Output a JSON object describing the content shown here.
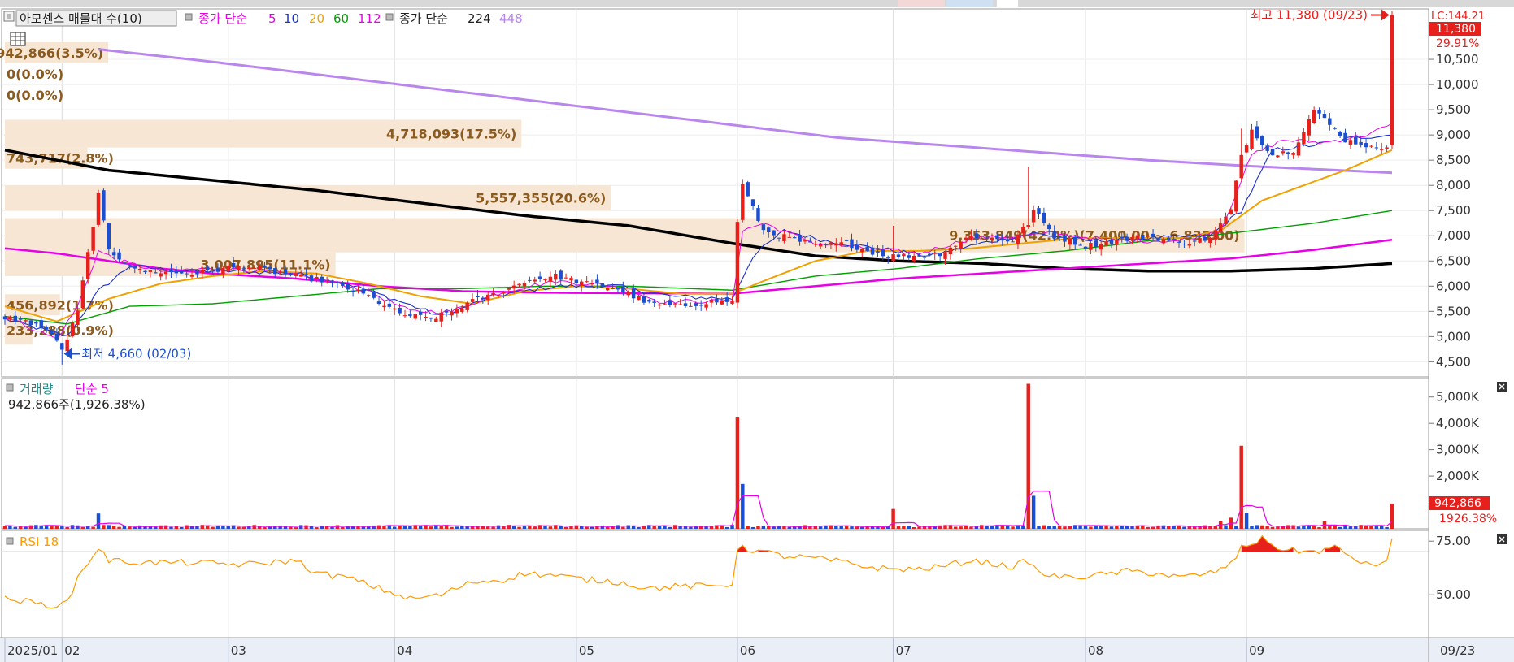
{
  "header": {
    "indicator_label": "아모센스 매물대 수(10)",
    "ma_label": "종가 단순",
    "ma_periods": [
      "5",
      "10",
      "20",
      "60",
      "112"
    ],
    "ma_periods_colors": [
      "#e800e8",
      "#1a30c8",
      "#f0a000",
      "#00a000",
      "#e800e8"
    ],
    "ma2_label": "종가 단순",
    "ma2_periods": [
      "224",
      "448"
    ],
    "ma2_periods_colors": [
      "#000000",
      "#b986ee"
    ],
    "right_top_label": "LC:144.21"
  },
  "price_panel": {
    "y_ticks": [
      "10,500",
      "10,000",
      "9,500",
      "9,000",
      "8,500",
      "8,000",
      "7,500",
      "7,000",
      "6,500",
      "6,000",
      "5,500",
      "5,000",
      "4,500"
    ],
    "y_tick_values": [
      10500,
      10000,
      9500,
      9000,
      8500,
      8000,
      7500,
      7000,
      6500,
      6000,
      5500,
      5000,
      4500
    ],
    "ylim": [
      4200,
      11500
    ],
    "current_price_tag": "11,380",
    "current_change_tag": "29.91%",
    "high_annotation": "최고 11,380 (09/23)",
    "low_annotation": "최저 4,660 (02/03)",
    "volume_profile": [
      {
        "label": "942,866(3.5%)",
        "low": 10420,
        "high": 10840,
        "frac": 0.075
      },
      {
        "label": "0(0.0%)",
        "low": 10000,
        "high": 10420,
        "frac": 0.0
      },
      {
        "label": "0(0.0%)",
        "low": 9590,
        "high": 10000,
        "frac": 0.0
      },
      {
        "label": "4,718,093(17.5%)",
        "low": 8750,
        "high": 9300,
        "frac": 0.375
      },
      {
        "label": "743,717(2.8%)",
        "low": 8330,
        "high": 8750,
        "frac": 0.06
      },
      {
        "label": "5,557,355(20.6%)",
        "low": 7500,
        "high": 8000,
        "frac": 0.44
      },
      {
        "label": "9,353,849(42.0%)(7,400.00 ~ 6,830.00)",
        "low": 6670,
        "high": 7350,
        "frac": 0.9
      },
      {
        "label": "3,007,895(11.1%)",
        "low": 6200,
        "high": 6670,
        "frac": 0.24
      },
      {
        "label": "456,892(1.7%)",
        "low": 5420,
        "high": 5840,
        "frac": 0.04
      },
      {
        "label": "233,288(0.9%)",
        "low": 4840,
        "high": 5420,
        "frac": 0.02
      }
    ]
  },
  "volume_panel": {
    "title": "거래량",
    "ma_label": "단순 5",
    "info": "942,866주(1,926.38%)",
    "y_ticks": [
      "5,000K",
      "4,000K",
      "3,000K",
      "2,000K",
      "1,000K"
    ],
    "y_tick_values": [
      5000,
      4000,
      3000,
      2000,
      1000
    ],
    "ylim": [
      0,
      5700
    ],
    "current_tag": "942,866",
    "current_pct": "1926.38%"
  },
  "rsi_panel": {
    "title": "RSI 18",
    "y_ticks": [
      "75.00",
      "50.00"
    ],
    "y_tick_values": [
      75,
      50
    ],
    "ylim": [
      30,
      80
    ]
  },
  "x_axis": {
    "labels": [
      "2025/01",
      "02",
      "03",
      "04",
      "05",
      "06",
      "07",
      "08",
      "09"
    ],
    "label_index": [
      0,
      11,
      43,
      75,
      110,
      141,
      171,
      208,
      239
    ],
    "right_label": "09/23"
  },
  "colors": {
    "up": "#e8201c",
    "down": "#1b4fd0",
    "ma5": "#e800e8",
    "ma10": "#1a30c8",
    "ma20": "#f0a000",
    "ma60": "#00a000",
    "ma112": "#e800e8",
    "ma224": "#000000",
    "ma448": "#b986ee",
    "rsi": "#ff9900",
    "profile": "#f7e6d3",
    "profile_text": "#8b5a1e",
    "grid": "#dcdcdc"
  },
  "chart_data": {
    "type": "candlestick",
    "title": "아모센스",
    "x_range": [
      "2025/01",
      "09/23"
    ],
    "ylim": [
      4200,
      11500
    ],
    "high": {
      "value": 11380,
      "date": "09/23"
    },
    "low": {
      "value": 4660,
      "date": "02/03"
    },
    "anchors": [
      [
        0,
        5380
      ],
      [
        6,
        5250
      ],
      [
        10,
        4950
      ],
      [
        11,
        4700
      ],
      [
        14,
        5500
      ],
      [
        18,
        7800
      ],
      [
        20,
        6700
      ],
      [
        26,
        6300
      ],
      [
        36,
        6250
      ],
      [
        46,
        6400
      ],
      [
        56,
        6200
      ],
      [
        62,
        6100
      ],
      [
        70,
        5800
      ],
      [
        76,
        5450
      ],
      [
        82,
        5350
      ],
      [
        86,
        5500
      ],
      [
        90,
        5700
      ],
      [
        96,
        5900
      ],
      [
        100,
        6100
      ],
      [
        106,
        6200
      ],
      [
        112,
        6050
      ],
      [
        118,
        5950
      ],
      [
        124,
        5650
      ],
      [
        130,
        5600
      ],
      [
        136,
        5700
      ],
      [
        140,
        5700
      ],
      [
        141,
        7300
      ],
      [
        142,
        8000
      ],
      [
        146,
        7100
      ],
      [
        156,
        6800
      ],
      [
        162,
        6850
      ],
      [
        166,
        6700
      ],
      [
        170,
        6600
      ],
      [
        176,
        6600
      ],
      [
        180,
        6650
      ],
      [
        186,
        7000
      ],
      [
        194,
        6900
      ],
      [
        197,
        7250
      ],
      [
        198,
        7500
      ],
      [
        202,
        7000
      ],
      [
        208,
        6800
      ],
      [
        214,
        6900
      ],
      [
        220,
        7000
      ],
      [
        226,
        6850
      ],
      [
        232,
        6950
      ],
      [
        236,
        7500
      ],
      [
        238,
        8600
      ],
      [
        240,
        9100
      ],
      [
        244,
        8600
      ],
      [
        248,
        8700
      ],
      [
        252,
        9500
      ],
      [
        258,
        8900
      ],
      [
        262,
        8800
      ],
      [
        264,
        8700
      ],
      [
        266,
        8800
      ],
      [
        267,
        11380
      ]
    ],
    "ma_anchors": {
      "ma5": [
        [
          0,
          5400
        ],
        [
          10,
          4950
        ],
        [
          14,
          5600
        ],
        [
          18,
          6700
        ],
        [
          22,
          6500
        ],
        [
          30,
          6300
        ],
        [
          40,
          6350
        ],
        [
          50,
          6300
        ],
        [
          60,
          6150
        ],
        [
          70,
          5900
        ],
        [
          78,
          5500
        ],
        [
          86,
          5500
        ],
        [
          96,
          5900
        ],
        [
          106,
          6100
        ],
        [
          118,
          6000
        ],
        [
          126,
          5700
        ],
        [
          140,
          5700
        ],
        [
          142,
          7100
        ],
        [
          146,
          7250
        ],
        [
          156,
          6850
        ],
        [
          166,
          6750
        ],
        [
          176,
          6650
        ],
        [
          186,
          6950
        ],
        [
          196,
          7000
        ],
        [
          202,
          7050
        ],
        [
          214,
          6900
        ],
        [
          226,
          6900
        ],
        [
          234,
          7100
        ],
        [
          240,
          8600
        ],
        [
          246,
          8900
        ],
        [
          254,
          8850
        ],
        [
          262,
          9000
        ],
        [
          267,
          9200
        ]
      ],
      "ma10": [
        [
          0,
          5350
        ],
        [
          12,
          5000
        ],
        [
          18,
          5900
        ],
        [
          24,
          6400
        ],
        [
          34,
          6300
        ],
        [
          44,
          6300
        ],
        [
          56,
          6250
        ],
        [
          66,
          6050
        ],
        [
          76,
          5700
        ],
        [
          84,
          5400
        ],
        [
          94,
          5800
        ],
        [
          106,
          6000
        ],
        [
          118,
          6000
        ],
        [
          128,
          5800
        ],
        [
          140,
          5750
        ],
        [
          144,
          6600
        ],
        [
          150,
          7100
        ],
        [
          158,
          6900
        ],
        [
          168,
          6750
        ],
        [
          178,
          6600
        ],
        [
          188,
          6850
        ],
        [
          198,
          7050
        ],
        [
          208,
          6900
        ],
        [
          220,
          6950
        ],
        [
          232,
          7000
        ],
        [
          238,
          7500
        ],
        [
          244,
          8700
        ],
        [
          252,
          8800
        ],
        [
          260,
          8950
        ],
        [
          267,
          9000
        ]
      ],
      "ma20": [
        [
          0,
          5600
        ],
        [
          10,
          5300
        ],
        [
          20,
          5750
        ],
        [
          30,
          6050
        ],
        [
          40,
          6200
        ],
        [
          50,
          6300
        ],
        [
          60,
          6250
        ],
        [
          70,
          6050
        ],
        [
          80,
          5800
        ],
        [
          90,
          5650
        ],
        [
          100,
          5900
        ],
        [
          110,
          6000
        ],
        [
          120,
          5950
        ],
        [
          130,
          5850
        ],
        [
          140,
          5850
        ],
        [
          146,
          6100
        ],
        [
          156,
          6500
        ],
        [
          166,
          6700
        ],
        [
          176,
          6700
        ],
        [
          186,
          6750
        ],
        [
          196,
          6850
        ],
        [
          206,
          6950
        ],
        [
          216,
          6950
        ],
        [
          226,
          6950
        ],
        [
          234,
          7100
        ],
        [
          242,
          7700
        ],
        [
          250,
          8000
        ],
        [
          258,
          8300
        ],
        [
          267,
          8700
        ]
      ],
      "ma60": [
        [
          0,
          5400
        ],
        [
          12,
          5250
        ],
        [
          24,
          5600
        ],
        [
          40,
          5650
        ],
        [
          56,
          5800
        ],
        [
          72,
          5950
        ],
        [
          88,
          5950
        ],
        [
          104,
          6000
        ],
        [
          120,
          6000
        ],
        [
          140,
          5920
        ],
        [
          156,
          6200
        ],
        [
          172,
          6350
        ],
        [
          188,
          6550
        ],
        [
          204,
          6700
        ],
        [
          220,
          6900
        ],
        [
          236,
          7050
        ],
        [
          252,
          7250
        ],
        [
          267,
          7500
        ]
      ],
      "ma112": [
        [
          0,
          6750
        ],
        [
          10,
          6650
        ],
        [
          20,
          6500
        ],
        [
          30,
          6350
        ],
        [
          40,
          6250
        ],
        [
          56,
          6150
        ],
        [
          72,
          6000
        ],
        [
          88,
          5900
        ],
        [
          104,
          5870
        ],
        [
          120,
          5860
        ],
        [
          140,
          5850
        ],
        [
          156,
          6000
        ],
        [
          172,
          6150
        ],
        [
          188,
          6250
        ],
        [
          204,
          6350
        ],
        [
          220,
          6450
        ],
        [
          236,
          6550
        ],
        [
          252,
          6720
        ],
        [
          267,
          6920
        ]
      ],
      "ma224": [
        [
          0,
          8700
        ],
        [
          20,
          8300
        ],
        [
          40,
          8100
        ],
        [
          60,
          7900
        ],
        [
          80,
          7650
        ],
        [
          100,
          7400
        ],
        [
          120,
          7200
        ],
        [
          140,
          6850
        ],
        [
          156,
          6600
        ],
        [
          172,
          6500
        ],
        [
          188,
          6450
        ],
        [
          204,
          6350
        ],
        [
          220,
          6300
        ],
        [
          236,
          6300
        ],
        [
          252,
          6350
        ],
        [
          267,
          6450
        ]
      ],
      "ma448": [
        [
          18,
          10700
        ],
        [
          40,
          10450
        ],
        [
          60,
          10200
        ],
        [
          80,
          9950
        ],
        [
          100,
          9700
        ],
        [
          120,
          9450
        ],
        [
          140,
          9200
        ],
        [
          160,
          8950
        ],
        [
          180,
          8800
        ],
        [
          200,
          8650
        ],
        [
          220,
          8500
        ],
        [
          240,
          8380
        ],
        [
          267,
          8250
        ]
      ]
    },
    "volume_spikes": [
      {
        "index": 18,
        "value": 580,
        "dir": "down"
      },
      {
        "index": 141,
        "value": 4250,
        "dir": "up"
      },
      {
        "index": 142,
        "value": 1700,
        "dir": "down"
      },
      {
        "index": 171,
        "value": 750,
        "dir": "up"
      },
      {
        "index": 197,
        "value": 5500,
        "dir": "up"
      },
      {
        "index": 198,
        "value": 1250,
        "dir": "down"
      },
      {
        "index": 234,
        "value": 300,
        "dir": "up"
      },
      {
        "index": 236,
        "value": 420,
        "dir": "up"
      },
      {
        "index": 238,
        "value": 3150,
        "dir": "up"
      },
      {
        "index": 239,
        "value": 600,
        "dir": "down"
      },
      {
        "index": 254,
        "value": 280,
        "dir": "up"
      },
      {
        "index": 267,
        "value": 950,
        "dir": "up"
      }
    ],
    "rsi_anchors": [
      [
        0,
        48
      ],
      [
        4,
        47
      ],
      [
        8,
        45
      ],
      [
        12,
        46
      ],
      [
        14,
        58
      ],
      [
        18,
        72
      ],
      [
        20,
        66
      ],
      [
        26,
        65
      ],
      [
        36,
        65
      ],
      [
        46,
        64
      ],
      [
        56,
        66
      ],
      [
        60,
        60
      ],
      [
        66,
        58
      ],
      [
        72,
        53
      ],
      [
        78,
        48
      ],
      [
        84,
        50
      ],
      [
        90,
        56
      ],
      [
        96,
        57
      ],
      [
        100,
        60
      ],
      [
        106,
        59
      ],
      [
        112,
        57
      ],
      [
        118,
        56
      ],
      [
        124,
        53
      ],
      [
        130,
        54
      ],
      [
        136,
        54
      ],
      [
        140,
        55
      ],
      [
        141,
        72
      ],
      [
        144,
        71
      ],
      [
        150,
        68
      ],
      [
        156,
        67
      ],
      [
        162,
        65
      ],
      [
        166,
        63
      ],
      [
        170,
        62
      ],
      [
        176,
        62
      ],
      [
        180,
        63
      ],
      [
        186,
        66
      ],
      [
        194,
        63
      ],
      [
        197,
        66
      ],
      [
        199,
        60
      ],
      [
        204,
        58
      ],
      [
        210,
        59
      ],
      [
        216,
        61
      ],
      [
        222,
        60
      ],
      [
        226,
        58
      ],
      [
        232,
        60
      ],
      [
        236,
        64
      ],
      [
        238,
        72
      ],
      [
        242,
        76
      ],
      [
        246,
        71
      ],
      [
        252,
        70
      ],
      [
        256,
        72
      ],
      [
        262,
        64
      ],
      [
        266,
        65
      ],
      [
        267,
        75
      ]
    ]
  }
}
